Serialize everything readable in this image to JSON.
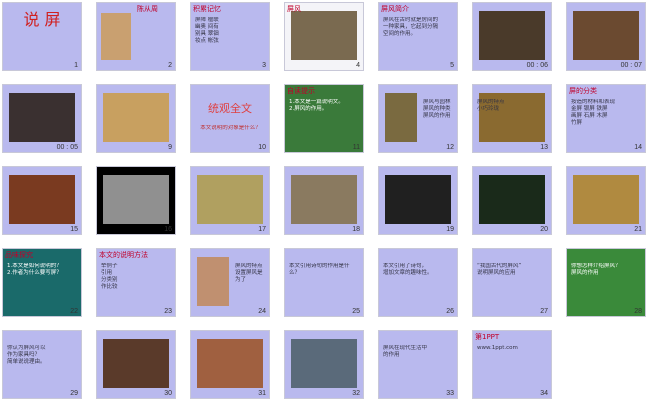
{
  "slides": [
    {
      "n": "1",
      "title": "说  屏",
      "kind": "cover",
      "bg": "#b9b9ee"
    },
    {
      "n": "2",
      "title": "陈从周",
      "kind": "portrait",
      "bg": "#b9b9ee"
    },
    {
      "n": "3",
      "title": "积累记忆",
      "body": "屏障 楹联\n幽奥 间有\n别具 翠钿\n妆点 帐弦",
      "kind": "text",
      "bg": "#b9b9ee"
    },
    {
      "n": "4",
      "title": "屏风",
      "kind": "photo",
      "bg": "#f4f4f8",
      "accent": "#7a6a50"
    },
    {
      "n": "5",
      "title": "屏风简介",
      "body": "屏风在古时就是房间的\n一种家具，它起到分隔\n空间的作用。",
      "kind": "text",
      "bg": "#b9b9ee"
    },
    {
      "n": "00 : 06",
      "title": "",
      "kind": "photo",
      "bg": "#b9b9ee",
      "accent": "#4a3a2a"
    },
    {
      "n": "00 : 07",
      "title": "",
      "kind": "photo",
      "bg": "#b9b9ee",
      "accent": "#6b4a30"
    },
    {
      "n": "00 : 05",
      "title": "",
      "kind": "photo",
      "bg": "#b9b9ee",
      "accent": "#3a3030"
    },
    {
      "n": "9",
      "title": "",
      "kind": "photo",
      "bg": "#b9b9ee",
      "accent": "#c8a060"
    },
    {
      "n": "10",
      "title": "统观全文",
      "body": "本文说明的对象是什么？",
      "kind": "headline",
      "bg": "#b9b9ee"
    },
    {
      "n": "11",
      "title": "自读提示",
      "body": "1.本文是一篇说明文。\n2.屏风的作用。",
      "kind": "text",
      "bg": "#3a7a3a"
    },
    {
      "n": "12",
      "title": "",
      "body": "屏风与园林\n屏风的种类\n屏风的作用",
      "kind": "photo-text",
      "bg": "#b9b9ee",
      "accent": "#7a6a40"
    },
    {
      "n": "13",
      "title": "",
      "body": "屏风的特点\n小巧玲珑",
      "kind": "photo",
      "bg": "#b9b9ee",
      "accent": "#8a6a30"
    },
    {
      "n": "14",
      "title": "屏的分类",
      "body": "按造的材料和表现\n金屏  银屏  铁屏\n画屏  石屏  木屏\n竹屏",
      "kind": "text",
      "bg": "#b9b9ee"
    },
    {
      "n": "15",
      "title": "",
      "kind": "photo",
      "bg": "#b9b9ee",
      "accent": "#7a3a20"
    },
    {
      "n": "16",
      "title": "",
      "kind": "photo",
      "bg": "#000000",
      "accent": "#909090"
    },
    {
      "n": "17",
      "title": "",
      "kind": "photo",
      "bg": "#b9b9ee",
      "accent": "#b0a060"
    },
    {
      "n": "18",
      "title": "",
      "kind": "photo",
      "bg": "#b9b9ee",
      "accent": "#8a7a60"
    },
    {
      "n": "19",
      "title": "",
      "kind": "photo",
      "bg": "#b9b9ee",
      "accent": "#202020"
    },
    {
      "n": "20",
      "title": "",
      "kind": "photo",
      "bg": "#b9b9ee",
      "accent": "#1a2a1a"
    },
    {
      "n": "21",
      "title": "",
      "kind": "photo",
      "bg": "#b9b9ee",
      "accent": "#b08a40"
    },
    {
      "n": "22",
      "title": "品味探究",
      "body": "1.本文是如何说明的？\n2.作者为什么要写屏？",
      "kind": "text",
      "bg": "#1a6a6a"
    },
    {
      "n": "23",
      "title": "本文的说明方法",
      "body": "举例子\n引用\n分类别\n作比较",
      "kind": "text",
      "bg": "#b9b9ee"
    },
    {
      "n": "24",
      "title": "",
      "body": "屏风的特点\n设置屏风是为了",
      "kind": "photo-text",
      "bg": "#b9b9ee",
      "accent": "#c09070"
    },
    {
      "n": "25",
      "title": "",
      "body": "本文引用诗句的作用是什么？",
      "kind": "text",
      "bg": "#b9b9ee"
    },
    {
      "n": "26",
      "title": "",
      "body": "本文引用了诗句，\n增加文章的趣味性。",
      "kind": "text",
      "bg": "#b9b9ee"
    },
    {
      "n": "27",
      "title": "",
      "body": "“我国古代的屏风”\n说明屏风的应用",
      "kind": "text",
      "bg": "#b9b9ee"
    },
    {
      "n": "28",
      "title": "",
      "body": "你想怎样介绍屏风？\n屏风的作用",
      "kind": "text",
      "bg": "#3a8a3a"
    },
    {
      "n": "29",
      "title": "",
      "body": "你认为屏风可以\n作为家具吗？\n简单说说理由。",
      "kind": "text",
      "bg": "#b9b9ee"
    },
    {
      "n": "30",
      "title": "",
      "kind": "photo",
      "bg": "#b9b9ee",
      "accent": "#5a3a2a"
    },
    {
      "n": "31",
      "title": "",
      "kind": "photo",
      "bg": "#b9b9ee",
      "accent": "#a06040"
    },
    {
      "n": "32",
      "title": "",
      "kind": "photo",
      "bg": "#b9b9ee",
      "accent": "#5a6a7a"
    },
    {
      "n": "33",
      "title": "",
      "body": "屏风在现代生活中\n的作用",
      "kind": "text",
      "bg": "#b9b9ee"
    },
    {
      "n": "34",
      "title": "第1PPT",
      "body": "www.1ppt.com",
      "kind": "text",
      "bg": "#b9b9ee"
    }
  ]
}
